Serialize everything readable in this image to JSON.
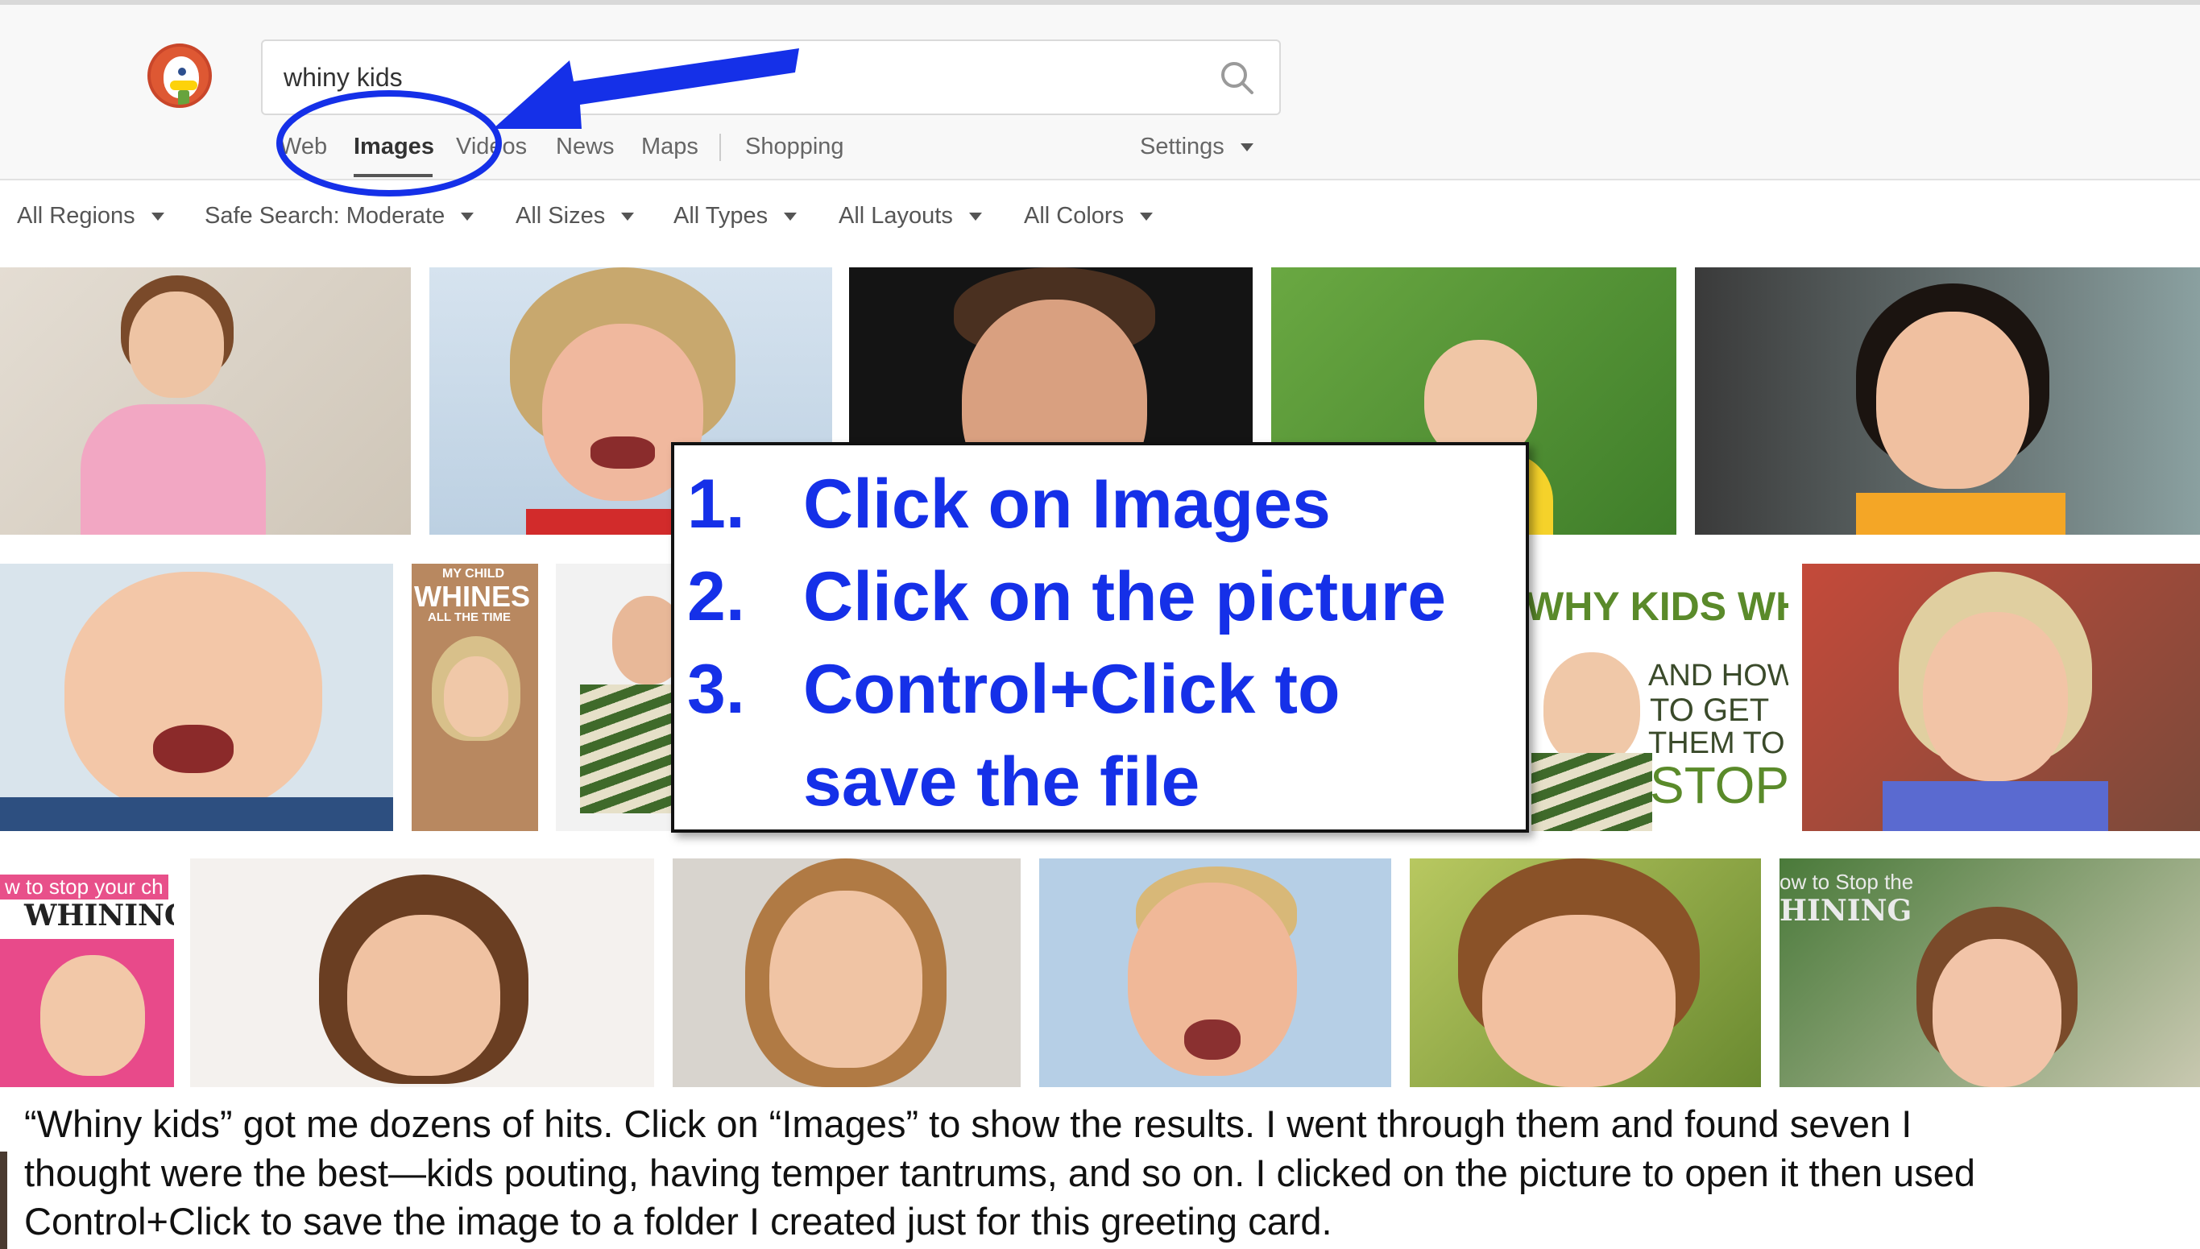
{
  "search": {
    "query": "whiny kids"
  },
  "nav": {
    "items": [
      {
        "label": "Web",
        "active": false
      },
      {
        "label": "Images",
        "active": true
      },
      {
        "label": "Videos",
        "active": false
      },
      {
        "label": "News",
        "active": false
      },
      {
        "label": "Maps",
        "active": false
      },
      {
        "label": "Shopping",
        "active": false
      }
    ],
    "settings_label": "Settings"
  },
  "filters": [
    {
      "label": "All Regions"
    },
    {
      "label": "Safe Search: Moderate"
    },
    {
      "label": "All Sizes"
    },
    {
      "label": "All Types"
    },
    {
      "label": "All Layouts"
    },
    {
      "label": "All Colors"
    }
  ],
  "thumb_text": {
    "t7_a": "MY CHILD",
    "t7_b": "WHINES",
    "t7_c": "ALL THE TIME",
    "t10_a": "WHY KIDS WHINE",
    "t10_b": "AND HOW",
    "t10_c": "TO GET",
    "t10_d": "THEM TO",
    "t10_e": "STOP",
    "t12_a": "w to stop your ch",
    "t12_b": "WHINING",
    "t17_a": "ow to Stop the",
    "t17_b": "HINING"
  },
  "callout": {
    "steps": [
      {
        "number": "1.",
        "text": "Click on Images"
      },
      {
        "number": "2.",
        "text": "Click on the picture"
      },
      {
        "number": "3.",
        "text": "Control+Click to"
      },
      {
        "number": "",
        "text": "save the file"
      }
    ],
    "color": "#1530e8"
  },
  "caption": {
    "lines": [
      "“Whiny kids” got me dozens of hits. Click on “Images” to show the results. I went through them and found seven I",
      "thought were the best—kids pouting, having temper tantrums, and so on. I clicked on the picture to open it then used",
      "Control+Click to save the image to a folder I created just for this greeting card."
    ]
  },
  "colors": {
    "brand": "#de5833",
    "annotation_blue": "#1530e8"
  }
}
